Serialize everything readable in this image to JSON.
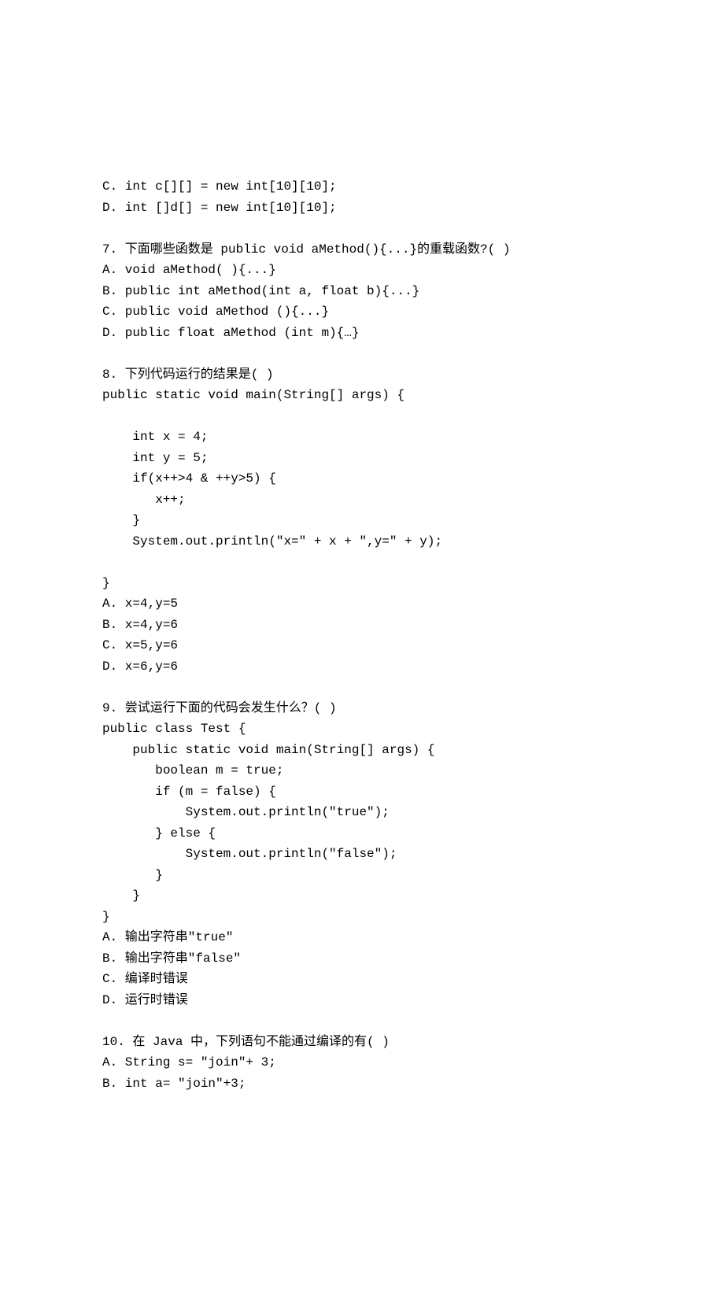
{
  "lines": [
    "C. int c[][] = new int[10][10];",
    "D. int []d[] = new int[10][10];",
    "",
    "7. 下面哪些函数是 public void aMethod(){...}的重载函数?( )",
    "A. void aMethod( ){...}",
    "B. public int aMethod(int a, float b){...}",
    "C. public void aMethod (){...}",
    "D. public float aMethod (int m){…}",
    "",
    "8. 下列代码运行的结果是( )",
    "public static void main(String[] args) {",
    "",
    "    int x = 4;",
    "    int y = 5;",
    "    if(x++>4 & ++y>5) {",
    "       x++;",
    "    }",
    "    System.out.println(\"x=\" + x + \",y=\" + y);",
    "",
    "}",
    "A. x=4,y=5",
    "B. x=4,y=6",
    "C. x=5,y=6",
    "D. x=6,y=6",
    "",
    "9. 尝试运行下面的代码会发生什么？( )",
    "public class Test {",
    "    public static void main(String[] args) {",
    "       boolean m = true;",
    "       if (m = false) {",
    "           System.out.println(\"true\");",
    "       } else {",
    "           System.out.println(\"false\");",
    "       }",
    "    }",
    "}",
    "A. 输出字符串\"true\"",
    "B. 输出字符串\"false\"",
    "C. 编译时错误",
    "D. 运行时错误",
    "",
    "10. 在 Java 中，下列语句不能通过编译的有( )",
    "A. String s= \"join\"+ 3;",
    "B. int a= \"join\"+3;"
  ]
}
